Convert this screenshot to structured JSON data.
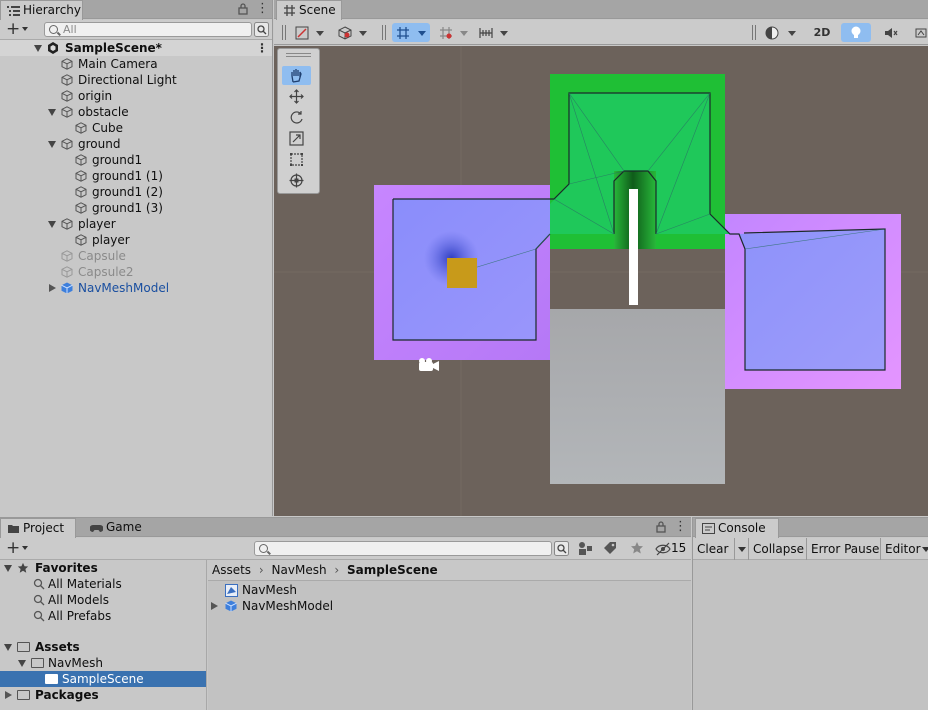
{
  "hierarchy": {
    "tab_label": "Hierarchy",
    "search_placeholder": "All",
    "scene_name": "SampleScene*",
    "items": [
      {
        "label": "Main Camera"
      },
      {
        "label": "Directional Light"
      },
      {
        "label": "origin"
      },
      {
        "label": "obstacle"
      },
      {
        "label": "Cube"
      },
      {
        "label": "ground"
      },
      {
        "label": "ground1"
      },
      {
        "label": "ground1 (1)"
      },
      {
        "label": "ground1 (2)"
      },
      {
        "label": "ground1 (3)"
      },
      {
        "label": "player"
      },
      {
        "label": "player"
      },
      {
        "label": "Capsule"
      },
      {
        "label": "Capsule2"
      },
      {
        "label": "NavMeshModel"
      }
    ]
  },
  "scene": {
    "tab_label": "Scene",
    "mode_2d_label": "2D"
  },
  "project": {
    "tabs": [
      {
        "label": "Project"
      },
      {
        "label": "Game"
      }
    ],
    "hidden_count": "15",
    "favorites_label": "Favorites",
    "favorites": [
      {
        "label": "All Materials"
      },
      {
        "label": "All Models"
      },
      {
        "label": "All Prefabs"
      }
    ],
    "assets_label": "Assets",
    "navmesh_folder": "NavMesh",
    "samplescene_folder": "SampleScene",
    "packages_label": "Packages",
    "breadcrumb": [
      "Assets",
      "NavMesh",
      "SampleScene"
    ],
    "files": [
      {
        "label": "NavMesh"
      },
      {
        "label": "NavMeshModel"
      }
    ]
  },
  "console": {
    "tab_label": "Console",
    "clear_label": "Clear",
    "collapse_label": "Collapse",
    "error_pause_label": "Error Pause",
    "editor_label": "Editor"
  },
  "colors": {
    "ground_purple": "#c386ff",
    "navmesh_blue": "#8a8dfb",
    "obstacle_green": "#28c83a",
    "selection": "#3a72b0",
    "viewport_bg": "#6c625b"
  }
}
